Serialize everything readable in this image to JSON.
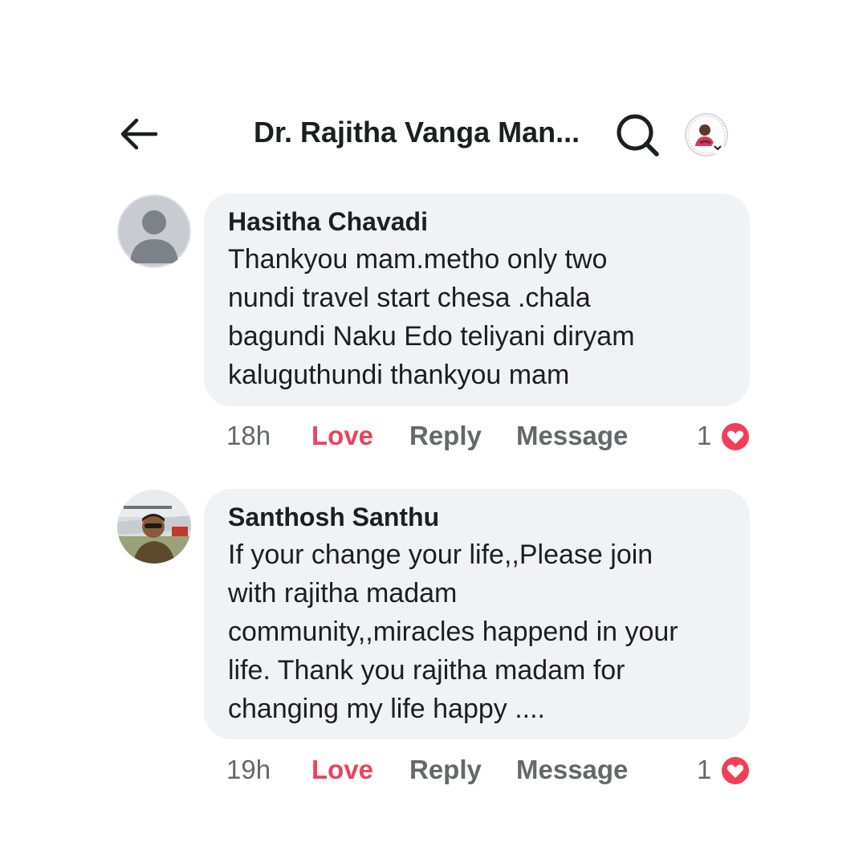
{
  "header": {
    "title": "Dr. Rajitha Vanga Man...",
    "back_icon": "arrow-left-icon",
    "search_icon": "search-icon",
    "avatar_icon": "profile-avatar"
  },
  "comments": [
    {
      "author": "Hasitha Chavadi",
      "text": "Thankyou mam.metho only two\nnundi travel start chesa .chala\nbagundi Naku Edo teliyani diryam\nkaluguthundi thankyou mam",
      "time": "18h",
      "love_label": "Love",
      "reply_label": "Reply",
      "message_label": "Message",
      "reaction_count": "1",
      "reaction_icon": "heart-icon"
    },
    {
      "author": "Santhosh Santhu",
      "text": "If your change your life,,Please join\nwith rajitha madam\ncommunity,,miracles happend in your\nlife. Thank you rajitha madam for\nchanging my life happy ....",
      "time": "19h",
      "love_label": "Love",
      "reply_label": "Reply",
      "message_label": "Message",
      "reaction_count": "1",
      "reaction_icon": "heart-icon"
    }
  ],
  "colors": {
    "love": "#e9445a",
    "heart_badge": "#f33e58",
    "bubble": "#f0f2f5",
    "secondary_text": "#65676b"
  }
}
